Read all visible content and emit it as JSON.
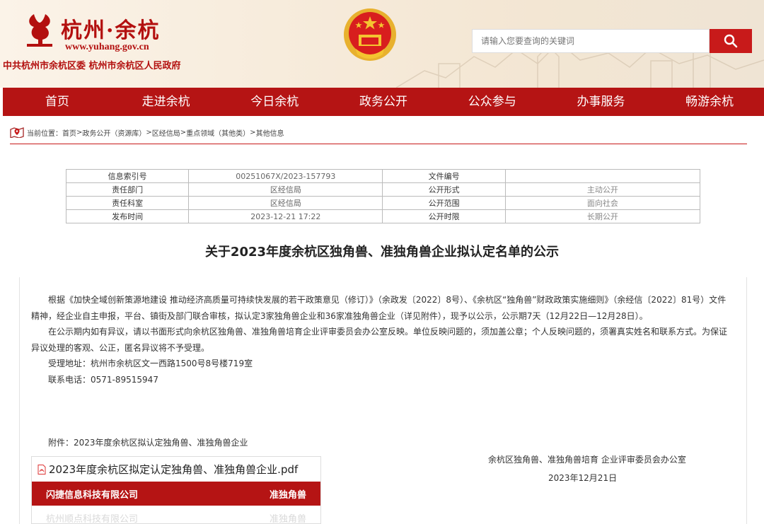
{
  "header": {
    "logo_text": "杭州·余杭",
    "logo_url": "www.yuhang.gov.cn",
    "org_text": "中共杭州市余杭区委  杭州市余杭区人民政府",
    "search_placeholder": "请输入您要查询的关键词",
    "colors": {
      "brand_red": "#b51414",
      "search_red": "#c81a1a"
    }
  },
  "nav": {
    "items": [
      "首页",
      "走进余杭",
      "今日余杭",
      "政务公开",
      "公众参与",
      "办事服务",
      "畅游余杭"
    ]
  },
  "breadcrumb": {
    "prefix": "当前位置：",
    "items": [
      "首页",
      "政务公开（资源库）",
      "区经信局",
      "重点领域（其他类）",
      "其他信息"
    ],
    "separator": "> "
  },
  "info_table": {
    "rows": [
      [
        "信息索引号",
        "00251067X/2023-157793",
        "文件编号",
        ""
      ],
      [
        "责任部门",
        "区经信局",
        "公开形式",
        "主动公开"
      ],
      [
        "责任科室",
        "区经信局",
        "公开范围",
        "面向社会"
      ],
      [
        "发布时间",
        "2023-12-21 17:22",
        "公开时限",
        "长期公开"
      ]
    ]
  },
  "document": {
    "title": "关于2023年度余杭区独角兽、准独角兽企业拟认定名单的公示",
    "para1": "根据《加快全域创新策源地建设 推动经济高质量可持续快发展的若干政策意见（修订）》（余政发〔2022〕8号）、《余杭区“独角兽”财政政策实施细则》（余经信〔2022〕81号）文件精神，经企业自主申报，平台、镇街及部门联合审核，拟认定3家独角兽企业和36家准独角兽企业（详见附件），现予以公示，公示期7天（12月22日—12月28日）。",
    "para2": "在公示期内如有异议，请以书面形式向余杭区独角兽、准独角兽培育企业评审委员会办公室反映。单位反映问题的，须加盖公章；个人反映问题的，须署真实姓名和联系方式。为保证异议处理的客观、公正，匿名异议将不予受理。",
    "address": "受理地址：杭州市余杭区文一西路1500号8号楼719室",
    "phone": "联系电话：0571-89515947",
    "attachment_label": "附件：2023年度余杭区拟认定独角兽、准独角兽企业",
    "signature": "余杭区独角兽、准独角兽培育  企业评审委员会办公室",
    "date": "2023年12月21日"
  },
  "attachment_preview": {
    "filename": "2023年度余杭区拟定认定独角兽、准独角兽企业.pdf",
    "rows": [
      {
        "company": "闪捷信息科技有限公司",
        "category": "准独角兽"
      },
      {
        "company": "杭州顺点科技有限公司",
        "category": "准独角兽"
      }
    ]
  }
}
